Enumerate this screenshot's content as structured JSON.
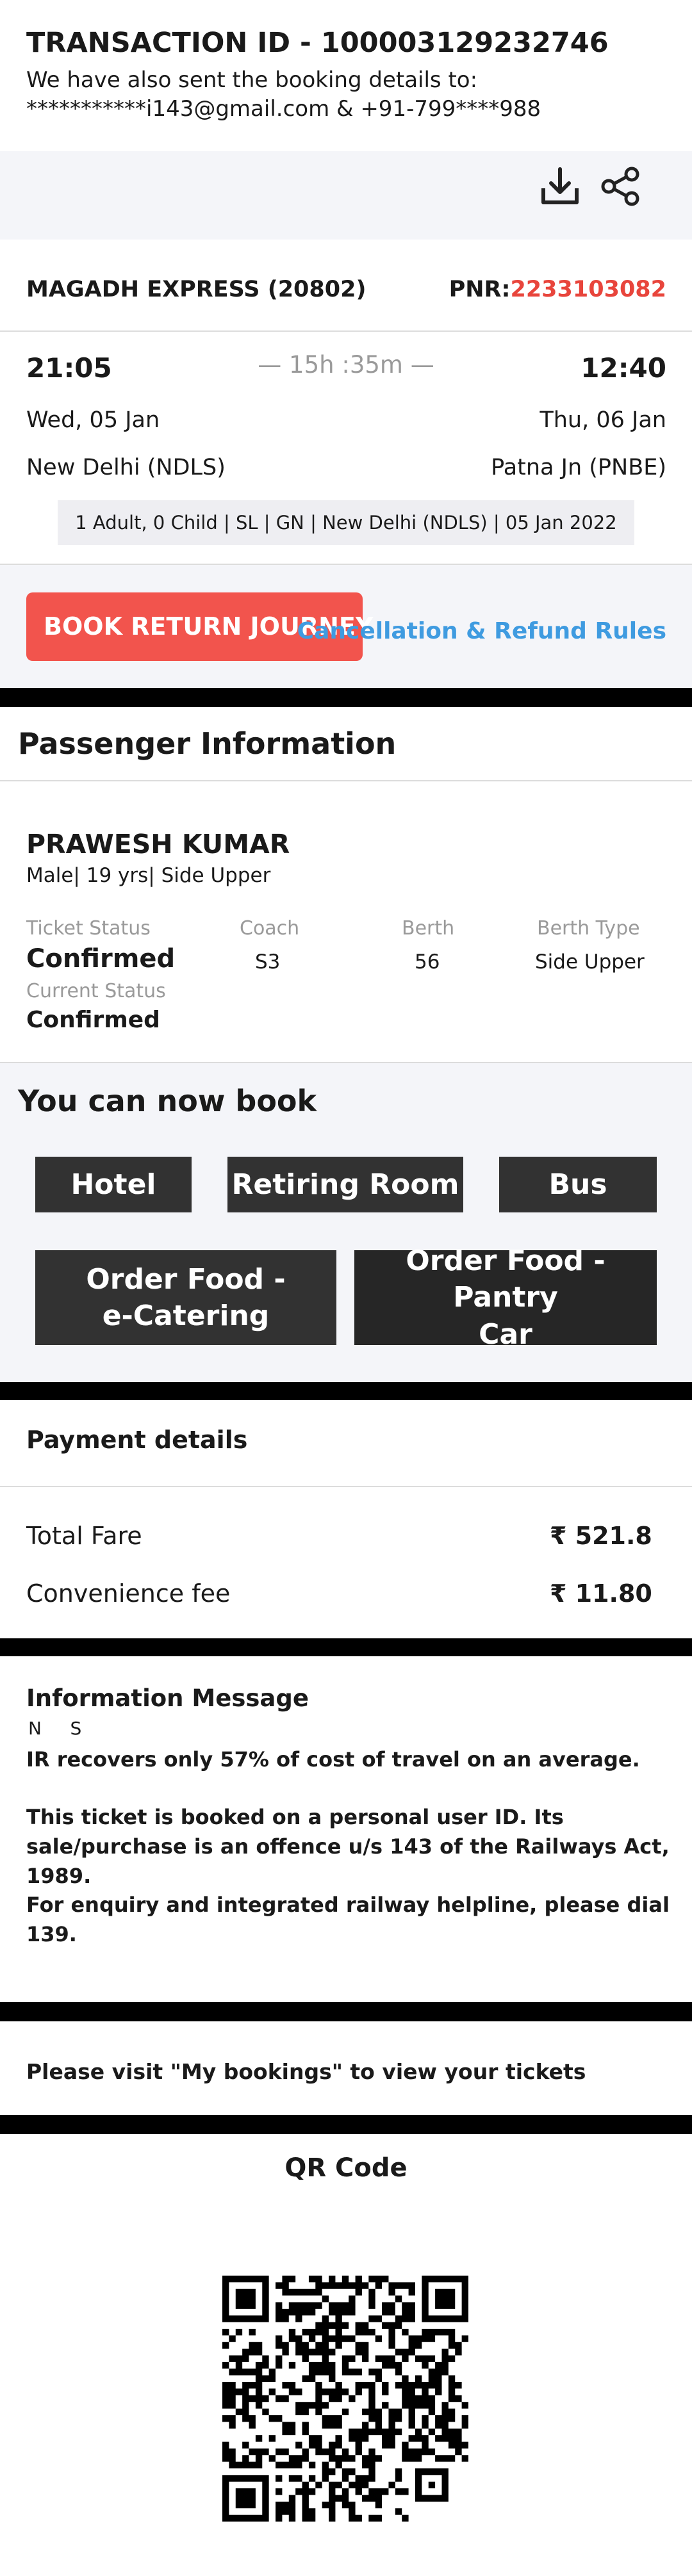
{
  "header": {
    "transaction_title": "TRANSACTION ID - 100003129232746",
    "sent_line1": "We have also sent the booking details to:",
    "sent_line2": "***********i143@gmail.com & +91-799****988",
    "icons": [
      "download-icon",
      "share-icon"
    ]
  },
  "train": {
    "name": "MAGADH EXPRESS",
    "number": "(20802)",
    "pnr_label": "PNR:",
    "pnr": "2233103082",
    "departure_time": "21:05",
    "arrival_time": "12:40",
    "duration": "— 15h :35m —",
    "departure_date": "Wed, 05 Jan",
    "arrival_date": "Thu, 06 Jan",
    "from_station": "New Delhi (NDLS)",
    "to_station": "Patna Jn (PNBE)",
    "summary": "1 Adult, 0 Child | SL | GN | New Delhi (NDLS) | 05 Jan 2022"
  },
  "actions": {
    "book_return": "BOOK RETURN JOURNEY",
    "cancellation": "Cancellation & Refund Rules"
  },
  "passenger": {
    "section_title": "Passenger Information",
    "name": "PRAWESH KUMAR",
    "details": "Male| 19 yrs| Side Upper",
    "ticket_status_label": "Ticket Status",
    "ticket_status": "Confirmed",
    "current_status_label": "Current Status",
    "current_status": "Confirmed",
    "coach_label": "Coach",
    "coach": "S3",
    "berth_label": "Berth",
    "berth": "56",
    "berth_type_label": "Berth Type",
    "berth_type": "Side Upper"
  },
  "book_now": {
    "title": "You can now book",
    "hotel": "Hotel",
    "retiring_room": "Retiring Room",
    "bus": "Bus",
    "food_ecatering_l1": "Order Food -",
    "food_ecatering_l2": "e-Catering",
    "food_pantry_l1": "Order Food - Pantry",
    "food_pantry_l2": "Car"
  },
  "payment": {
    "title": "Payment details",
    "total_fare_label": "Total Fare",
    "total_fare": "₹  521.8",
    "convenience_label": "Convenience fee",
    "convenience": "₹  11.80"
  },
  "info": {
    "title": "Information Message",
    "ns": "N     S",
    "msg1": "IR recovers only 57% of cost of travel on an average.",
    "msg2": "This ticket is booked on a personal user ID. Its sale/purchase is an offence u/s 143 of the Railways Act, 1989.",
    "msg3": "For enquiry and integrated railway helpline, please dial 139."
  },
  "bookings_note": "Please visit \"My bookings\" to view your tickets",
  "qr": {
    "title": "QR Code"
  },
  "colors": {
    "accent_red": "#f2544d",
    "pnr_red": "#e8453c",
    "link_blue": "#3f9be0",
    "tile_dark": "#323232"
  }
}
